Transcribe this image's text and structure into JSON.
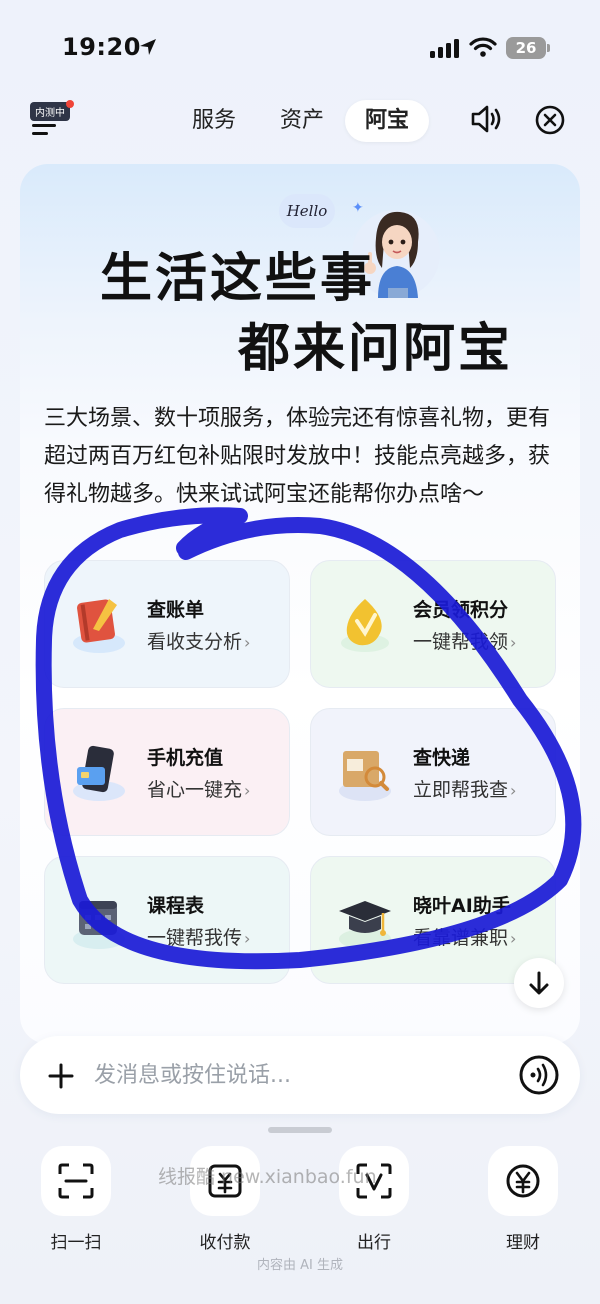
{
  "status_bar": {
    "time": "19:20",
    "battery": "26"
  },
  "top_nav": {
    "beta_badge": "内测中",
    "tabs": [
      {
        "label": "服务",
        "active": false
      },
      {
        "label": "资产",
        "active": false
      },
      {
        "label": "阿宝",
        "active": true
      }
    ]
  },
  "hero": {
    "hello": "Hello",
    "line1": "生活这些事",
    "line2": "都来问阿宝",
    "intro": "三大场景、数十项服务，体验完还有惊喜礼物，更有超过两百万红包补贴限时发放中！技能点亮越多，获得礼物越多。快来试试阿宝还能帮你办点啥～"
  },
  "services": [
    {
      "title": "查账单",
      "subtitle": "看收支分析",
      "icon": "notebook-icon",
      "tint": "#eef5fb"
    },
    {
      "title": "会员领积分",
      "subtitle": "一键帮我领",
      "icon": "gold-coin-icon",
      "tint": "#eef8f0"
    },
    {
      "title": "手机充值",
      "subtitle": "省心一键充",
      "icon": "phone-card-icon",
      "tint": "#fbf0f4"
    },
    {
      "title": "查快递",
      "subtitle": "立即帮我查",
      "icon": "parcel-icon",
      "tint": "#f1f3fb"
    },
    {
      "title": "课程表",
      "subtitle": "一键帮我传",
      "icon": "calendar-icon",
      "tint": "#edf7f7"
    },
    {
      "title": "晓叶AI助手",
      "subtitle": "看靠谱兼职",
      "icon": "graduation-cap-icon",
      "tint": "#eef8f1"
    }
  ],
  "chat": {
    "placeholder": "发消息或按住说话..."
  },
  "dock": [
    {
      "label": "扫一扫",
      "icon": "scan-icon"
    },
    {
      "label": "收付款",
      "icon": "payment-icon"
    },
    {
      "label": "出行",
      "icon": "transit-icon"
    },
    {
      "label": "理财",
      "icon": "yuan-icon"
    }
  ],
  "watermark": "线报酷 new.xianbao.fun",
  "footnote": "内容由 AI 生成",
  "colors": {
    "annotation_stroke": "#1a1ad6",
    "accent": "#5b8ff9"
  }
}
